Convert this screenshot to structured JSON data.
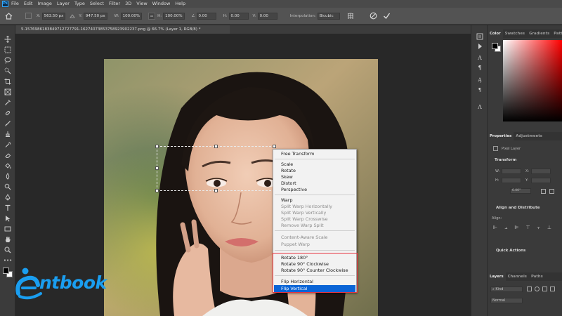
{
  "app": {
    "logo_text": "Ps"
  },
  "menu": [
    "File",
    "Edit",
    "Image",
    "Layer",
    "Type",
    "Select",
    "Filter",
    "3D",
    "View",
    "Window",
    "Help"
  ],
  "options": {
    "x_label": "X:",
    "x_value": "563.50 px",
    "y_label": "Y:",
    "y_value": "947.50 px",
    "w_label": "W:",
    "w_value": "100.00%",
    "h_label": "H:",
    "h_value": "100.00%",
    "angle_value": "0.00",
    "hskew_label": "H:",
    "hskew_value": "0.00",
    "vskew_label": "V:",
    "vskew_value": "0.00",
    "interp_label": "Interpolation:",
    "interp_value": "Bicubic"
  },
  "document": {
    "tab_title": "5-1576986183849712727791-16274073853758923902237.png @ 66.7% (Layer 1, RGB/8) *"
  },
  "context_menu": {
    "header": "Free Transform",
    "group_basic": [
      "Scale",
      "Rotate",
      "Skew",
      "Distort",
      "Perspective"
    ],
    "warp": "Warp",
    "warp_disabled": [
      "Split Warp Horizontally",
      "Split Warp Vertically",
      "Split Warp Crosswise",
      "Remove Warp Split"
    ],
    "content_disabled": [
      "Content-Aware Scale",
      "Puppet Warp"
    ],
    "rotate": [
      "Rotate 180°",
      "Rotate 90° Clockwise",
      "Rotate 90° Counter Clockwise"
    ],
    "flip_horizontal": "Flip Horizontal",
    "flip_vertical": "Flip Vertical"
  },
  "panels": {
    "color_tabs": [
      "Color",
      "Swatches",
      "Gradients",
      "Patterns"
    ],
    "props_tabs": [
      "Properties",
      "Adjustments"
    ],
    "pixel_layer": "Pixel Layer",
    "transform": "Transform",
    "w_label": "W:",
    "h_label": "H:",
    "x_label": "X:",
    "y_label": "Y:",
    "angle_value": "0.00°",
    "align_distribute": "Align and Distribute",
    "align_label": "Align:",
    "quick_actions": "Quick Actions",
    "layers_tabs": [
      "Layers",
      "Channels",
      "Paths"
    ],
    "kind_label": "Kind",
    "blend_mode": "Normal"
  },
  "watermark": {
    "text": "ntbook"
  },
  "colors": {
    "menubar": "#4a4a4a",
    "optbar": "#535353",
    "panel": "#3a3a3a",
    "highlight": "#0a64d6",
    "red_outline": "#e8343f",
    "logo": "#1a9ef0"
  }
}
